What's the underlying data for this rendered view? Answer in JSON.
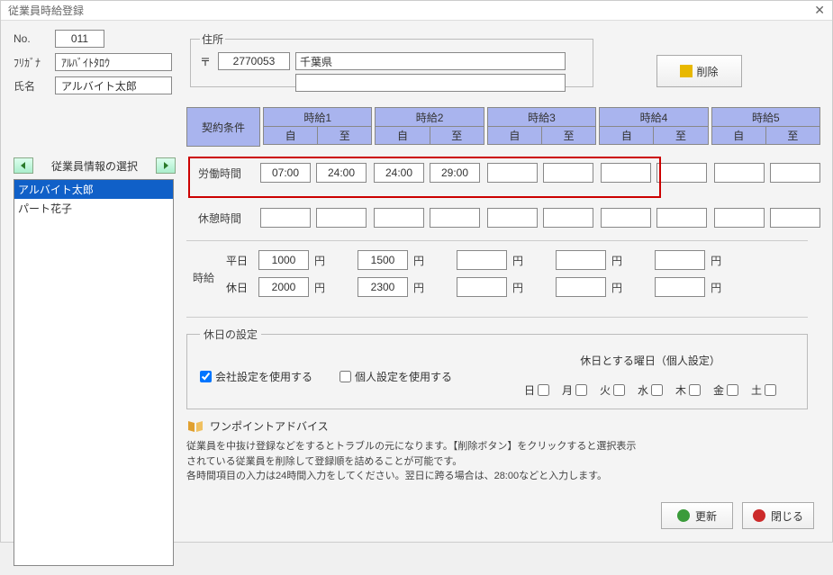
{
  "window": {
    "title": "従業員時給登録"
  },
  "employee": {
    "no_label": "No.",
    "no": "011",
    "furigana_label": "ﾌﾘｶﾞﾅ",
    "furigana": "ｱﾙﾊﾞｲﾄﾀﾛｳ",
    "name_label": "氏名",
    "name": "アルバイト太郎"
  },
  "address": {
    "legend": "住所",
    "mark": "〒",
    "zip": "2770053",
    "line1": "千葉県",
    "line2": ""
  },
  "delete_btn": "削除",
  "emp_select": {
    "label": "従業員情報の選択",
    "items": [
      "アルバイト太郎",
      "パート花子"
    ],
    "selected_index": 0
  },
  "headers": {
    "contract": "契約条件",
    "wage_cols": [
      "時給1",
      "時給2",
      "時給3",
      "時給4",
      "時給5"
    ],
    "from": "自",
    "to": "至"
  },
  "rows": {
    "work_label": "労働時間",
    "work": [
      {
        "from": "07:00",
        "to": "24:00"
      },
      {
        "from": "24:00",
        "to": "29:00"
      },
      {
        "from": "",
        "to": ""
      },
      {
        "from": "",
        "to": ""
      },
      {
        "from": "",
        "to": ""
      }
    ],
    "break_label": "休憩時間",
    "break": [
      {
        "from": "",
        "to": ""
      },
      {
        "from": "",
        "to": ""
      },
      {
        "from": "",
        "to": ""
      },
      {
        "from": "",
        "to": ""
      },
      {
        "from": "",
        "to": ""
      }
    ]
  },
  "wage": {
    "side_label": "時給",
    "weekday_label": "平日",
    "holiday_label": "休日",
    "yen": "円",
    "weekday": [
      "1000",
      "1500",
      "",
      "",
      ""
    ],
    "holiday": [
      "2000",
      "2300",
      "",
      "",
      ""
    ]
  },
  "holiday_settings": {
    "legend": "休日の設定",
    "use_company": "会社設定を使用する",
    "use_company_checked": true,
    "use_personal": "個人設定を使用する",
    "use_personal_checked": false,
    "right_title": "休日とする曜日（個人設定）",
    "days": [
      "日",
      "月",
      "火",
      "水",
      "木",
      "金",
      "土"
    ]
  },
  "advice": {
    "title": "ワンポイントアドバイス",
    "text1": "従業員を中抜け登録などをするとトラブルの元になります。【削除ボタン】をクリックすると選択表示",
    "text2": "されている従業員を削除して登録順を詰めることが可能です。",
    "text3": "各時間項目の入力は24時間入力をしてください。翌日に跨る場合は、28:00などと入力します。"
  },
  "buttons": {
    "update": "更新",
    "close": "閉じる"
  }
}
